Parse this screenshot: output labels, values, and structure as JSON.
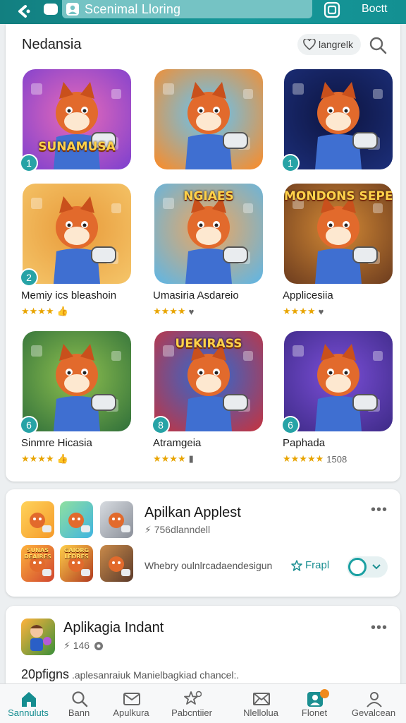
{
  "topbar": {
    "search_text": "Scenimal Lloring",
    "right_label": "Boctt"
  },
  "section": {
    "title": "Nedansia",
    "pill_label": "langrelk"
  },
  "grid": [
    {
      "badge": "1",
      "name": "",
      "stars": "",
      "extra": "",
      "art": "SUNAMUSA",
      "bg1": "#7b3fcf",
      "bg2": "#e96bb8"
    },
    {
      "badge": "",
      "name": "",
      "stars": "",
      "extra": "",
      "art": "",
      "bg1": "#ff8a22",
      "bg2": "#5cc6ff"
    },
    {
      "badge": "1",
      "name": "",
      "stars": "",
      "extra": "",
      "art": "",
      "bg1": "#1c2f7a",
      "bg2": "#0d1440"
    },
    {
      "badge": "2",
      "name": "Memiy ics bleashoin",
      "stars": "★★★★",
      "extra": "👍",
      "art": "",
      "bg1": "#f5c66a",
      "bg2": "#e89a3a"
    },
    {
      "badge": "",
      "name": "Umasiria Asdareio",
      "stars": "★★★★",
      "extra": "♥",
      "art": "NGIAES",
      "bg1": "#5bb6e8",
      "bg2": "#f2a65c"
    },
    {
      "badge": "",
      "name": "Applicesiia",
      "stars": "★★★★",
      "extra": "♥",
      "art": "MONDONS SEPERS",
      "bg1": "#6b3b1e",
      "bg2": "#d48a35"
    },
    {
      "badge": "6",
      "name": "Sinmre Hicasia",
      "stars": "★★★★",
      "extra": "👍",
      "art": "",
      "bg1": "#2f6f3a",
      "bg2": "#8fc04f"
    },
    {
      "badge": "8",
      "name": "Atramgeia",
      "stars": "★★★★",
      "extra": "▮",
      "art": "UEKIRASS",
      "bg1": "#c8323c",
      "bg2": "#2a6bd6"
    },
    {
      "badge": "6",
      "name": "Paphada",
      "stars": "★★★★★",
      "extra": "1508",
      "art": "",
      "bg1": "#3d2a86",
      "bg2": "#7b4fd8"
    }
  ],
  "card2": {
    "title": "Apilkan Applest",
    "subtitle": "⚡ 756dlanndell",
    "description": "Whebry oulnlrcadaendesigun",
    "link_label": "Frapl",
    "mini_icons": [
      {
        "bg1": "#f59a2a",
        "bg2": "#ffd35a",
        "art": ""
      },
      {
        "bg1": "#3fb4e0",
        "bg2": "#8fe0a0",
        "art": ""
      },
      {
        "bg1": "#8a8f99",
        "bg2": "#d7dbe0",
        "art": ""
      },
      {
        "bg1": "#d0452f",
        "bg2": "#ffb33c",
        "art": "SUNAS DEAIRES"
      },
      {
        "bg1": "#b03a20",
        "bg2": "#ffcf4a",
        "art": "GAIORG LEDRES"
      },
      {
        "bg1": "#5b3a2a",
        "bg2": "#c98a4a",
        "art": ""
      }
    ]
  },
  "card3": {
    "title": "Aplikagia Indant",
    "subtitle": "⚡ 146",
    "description_main": "20pfigns",
    "description_rest": " .aplesanraiuk Manielbagkiad chancel:."
  },
  "nav": [
    {
      "label": "Sannuluts",
      "icon": "home-icon"
    },
    {
      "label": "Bann",
      "icon": "search-icon"
    },
    {
      "label": "Apulkura",
      "icon": "mail-icon"
    },
    {
      "label": "Pabcntiier",
      "icon": "star-icon"
    },
    {
      "label": "Nlellolua",
      "icon": "envelope-icon"
    },
    {
      "label": "Flonet",
      "icon": "user-badge-icon"
    },
    {
      "label": "Gevalcean",
      "icon": "profile-icon"
    }
  ],
  "colors": {
    "accent": "#17989a",
    "star": "#e8a400"
  }
}
